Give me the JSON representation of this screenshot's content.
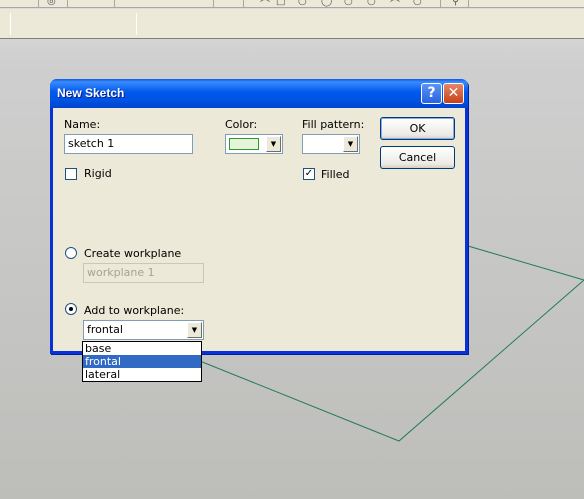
{
  "colors": {
    "titlebar": "#0054e3",
    "dialog_bg": "#ece9d8",
    "workplane_line": "#1e7a58",
    "swatch_fill": "#e6f4dc",
    "swatch_border": "#2b9a2b",
    "selection": "#316ac5"
  },
  "dialog": {
    "title": "New Sketch",
    "help_icon": "?",
    "close_icon": "✕",
    "name_label": "Name:",
    "name_value": "sketch 1",
    "color_label": "Color:",
    "fill_pattern_label": "Fill pattern:",
    "rigid_label": "Rigid",
    "rigid_checked": false,
    "filled_label": "Filled",
    "filled_checked": true,
    "filled_mark": "✓",
    "create_workplane_label": "Create workplane",
    "create_workplane_placeholder": "workplane 1",
    "add_to_workplane_label": "Add to workplane:",
    "add_to_workplane_value": "frontal",
    "workplane_mode": "add_to_workplane",
    "ok_label": "OK",
    "cancel_label": "Cancel",
    "dropdown_options": [
      "base",
      "frontal",
      "lateral"
    ],
    "dropdown_selected": "frontal",
    "combo_arrow": "▼"
  }
}
